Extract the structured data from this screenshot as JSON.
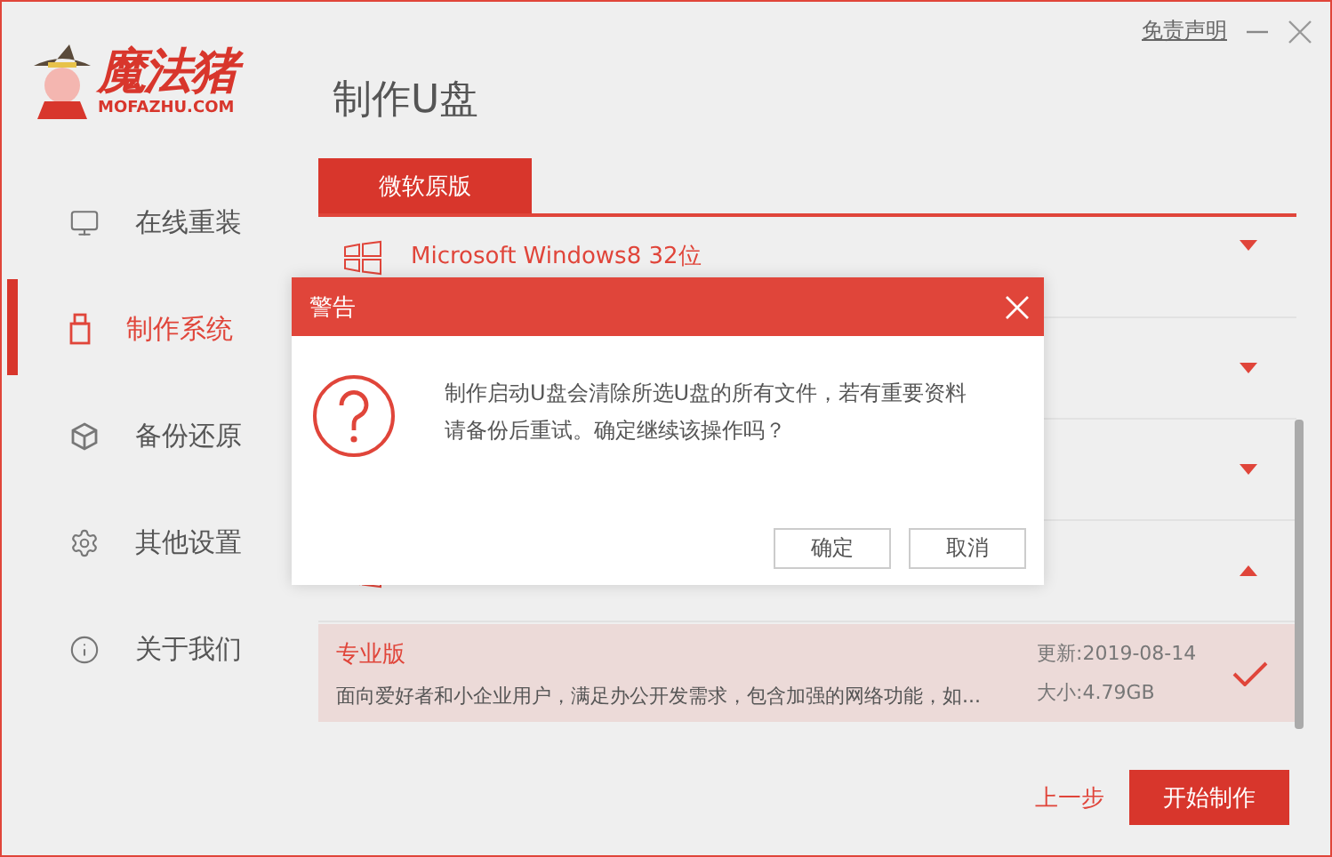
{
  "window": {
    "disclaimer": "免责声明"
  },
  "logo": {
    "name": "魔法猪",
    "domain": "MOFAZHU.COM"
  },
  "page_title": "制作U盘",
  "sidebar": {
    "items": [
      {
        "label": "在线重装",
        "kind": "monitor",
        "selected": false
      },
      {
        "label": "制作系统",
        "kind": "usb",
        "selected": true
      },
      {
        "label": "备份还原",
        "kind": "cube",
        "selected": false
      },
      {
        "label": "其他设置",
        "kind": "gear",
        "selected": false
      },
      {
        "label": "关于我们",
        "kind": "info",
        "selected": false
      }
    ]
  },
  "tabs": [
    {
      "label": "微软原版",
      "selected": true
    }
  ],
  "os_list": [
    {
      "name": "Microsoft Windows8 32位",
      "expanded": false
    },
    {
      "expanded": false
    },
    {
      "expanded": false
    },
    {
      "expanded": true,
      "editions": [
        {
          "name": "专业版",
          "description": "面向爱好者和小企业用户，满足办公开发需求，包含加强的网络功能，如...",
          "updated": "更新:2019-08-14",
          "size": "大小:4.79GB",
          "selected": true
        }
      ]
    }
  ],
  "dialog": {
    "title": "警告",
    "message": "制作启动U盘会清除所选U盘的所有文件，若有重要资料请备份后重试。确定继续该操作吗？",
    "buttons": [
      "确定",
      "取消"
    ]
  },
  "footer": {
    "back": "上一步",
    "start": "开始制作"
  }
}
